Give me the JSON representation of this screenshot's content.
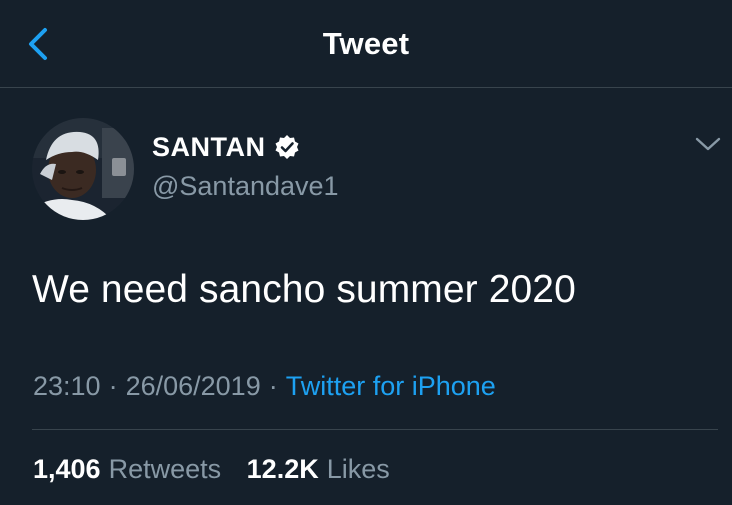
{
  "header": {
    "title": "Tweet",
    "back_icon": "chevron-left-icon"
  },
  "author": {
    "display_name": "SANTAN",
    "handle": "@Santandave1",
    "verified": true
  },
  "tweet": {
    "text": "We need sancho summer 2020",
    "time": "23:10",
    "date": "26/06/2019",
    "separator": "·",
    "source": "Twitter for iPhone"
  },
  "stats": {
    "retweets_count": "1,406",
    "retweets_label": "Retweets",
    "likes_count": "12.2K",
    "likes_label": "Likes"
  },
  "colors": {
    "background": "#15202b",
    "accent": "#1da1f2",
    "secondary_text": "#8899a6",
    "divider": "#38444d"
  }
}
